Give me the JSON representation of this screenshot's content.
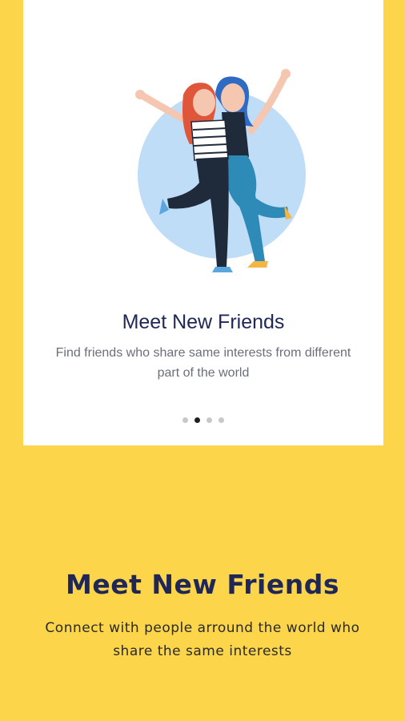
{
  "card": {
    "title": "Meet New Friends",
    "description": "Find friends who share same interests from different part of the world",
    "illustration": "two-friends-hugging-illustration"
  },
  "pagination": {
    "total": 4,
    "active_index": 1
  },
  "bottom": {
    "title": "Meet New Friends",
    "description": "Connect with people arround the world who share the same interests"
  },
  "colors": {
    "background": "#FCD54A",
    "card": "#FFFFFF",
    "title": "#1F2757",
    "circle": "#BFDDF7"
  }
}
